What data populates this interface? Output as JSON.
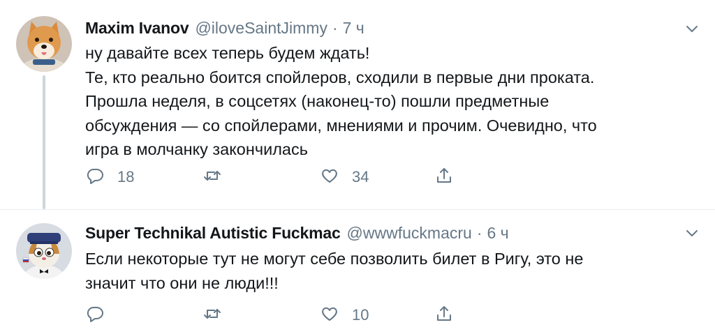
{
  "tweets": [
    {
      "author_name": "Maxim Ivanov",
      "handle": "@iloveSaintJimmy",
      "separator": "·",
      "time": "7 ч",
      "lines": [
        "ну давайте всех теперь будем ждать!",
        "Те, кто реально боится спойлеров, сходили в первые дни проката.",
        "Прошла неделя, в соцсетях (наконец-то) пошли предметные",
        "обсуждения — со спойлерами, мнениями и прочим. Очевидно, что",
        "игра в молчанку закончилась"
      ],
      "replies": "18",
      "retweets": "",
      "likes": "34"
    },
    {
      "author_name": "Super Technikal Autistic Fuckmac",
      "handle": "@wwwfuckmacru",
      "separator": "·",
      "time": "6 ч",
      "lines": [
        "Если некоторые тут не могут себе позволить билет в Ригу, это не",
        "значит что они не люди!!!"
      ],
      "replies": "",
      "retweets": "",
      "likes": "10"
    }
  ],
  "icons": {
    "reply": "reply-icon",
    "retweet": "retweet-icon",
    "like": "heart-icon",
    "share": "share-icon",
    "caret": "chevron-down-icon"
  },
  "colors": {
    "text": "#14171a",
    "secondary": "#657786",
    "thread_line": "#ccd6dd",
    "divider": "#e6ecf0"
  }
}
